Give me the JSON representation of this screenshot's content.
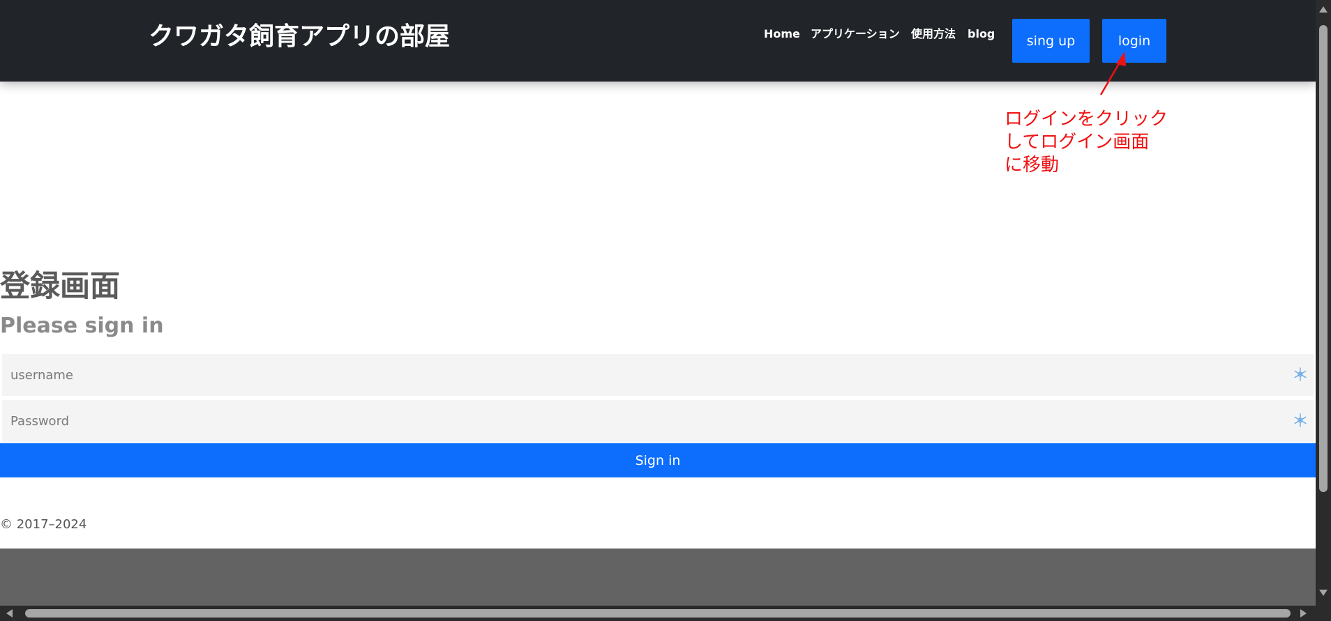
{
  "navbar": {
    "brand": "クワガタ飼育アプリの部屋",
    "links": [
      {
        "label": "Home"
      },
      {
        "label": "アプリケーション"
      },
      {
        "label": "使用方法"
      },
      {
        "label": "blog"
      }
    ],
    "signup_label": "sing up",
    "login_label": "login"
  },
  "annotation": {
    "lines": [
      "ログインをクリック",
      "してログイン画面",
      "に移動"
    ],
    "color": "#ee1111"
  },
  "form": {
    "heading": "登録画面",
    "subheading": "Please sign in",
    "username_placeholder": "username",
    "password_placeholder": "Password",
    "submit_label": "Sign in"
  },
  "footer": {
    "copyright": "© 2017–2024"
  },
  "colors": {
    "navbar_bg": "#212529",
    "accent": "#0d6efd",
    "field_bg": "#f4f4f4"
  },
  "icons": {
    "field_icon": "snowflake-icon"
  }
}
